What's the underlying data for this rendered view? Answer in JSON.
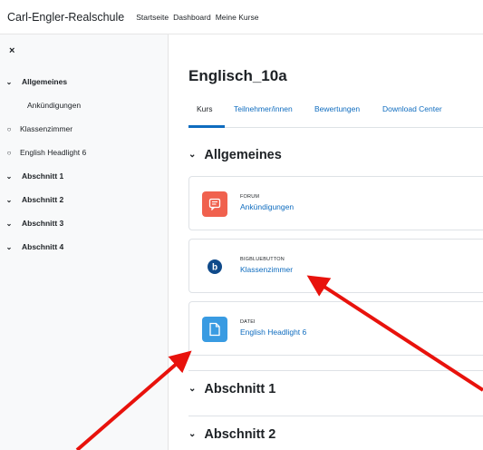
{
  "navbar": {
    "brand": "Carl-Engler-Realschule",
    "links": [
      "Startseite",
      "Dashboard",
      "Meine Kurse"
    ]
  },
  "drawer": {
    "close_icon": "×",
    "items": [
      {
        "label": "Allgemeines",
        "type": "section",
        "marker": "chevron-down"
      },
      {
        "label": "Ankündigungen",
        "type": "activity",
        "marker": "none"
      },
      {
        "label": "Klassenzimmer",
        "type": "activity",
        "marker": "circle"
      },
      {
        "label": "English Headlight 6",
        "type": "activity",
        "marker": "circle"
      },
      {
        "label": "Abschnitt 1",
        "type": "section",
        "marker": "chevron-down"
      },
      {
        "label": "Abschnitt 2",
        "type": "section",
        "marker": "chevron-down"
      },
      {
        "label": "Abschnitt 3",
        "type": "section",
        "marker": "chevron-down"
      },
      {
        "label": "Abschnitt 4",
        "type": "section",
        "marker": "chevron-down"
      }
    ]
  },
  "course": {
    "title": "Englisch_10a",
    "tabs": [
      "Kurs",
      "Teilnehmer/innen",
      "Bewertungen",
      "Download Center"
    ],
    "active_tab": "Kurs",
    "sections": [
      {
        "title": "Allgemeines",
        "activities": [
          {
            "type": "FORUM",
            "name": "Ankündigungen",
            "icon": "forum-icon",
            "color": "#f0614e"
          },
          {
            "type": "BIGBLUEBUTTON",
            "name": "Klassenzimmer",
            "icon": "bigbluebutton-icon",
            "color": "#0f4a8a"
          },
          {
            "type": "DATEI",
            "name": "English Headlight 6",
            "icon": "file-icon",
            "color": "#399be2"
          }
        ]
      },
      {
        "title": "Abschnitt 1"
      },
      {
        "title": "Abschnitt 2"
      }
    ]
  },
  "colors": {
    "link": "#0f6cbf",
    "drawer_bg": "#f8f9fa",
    "annotation_arrow": "#e8120c"
  }
}
